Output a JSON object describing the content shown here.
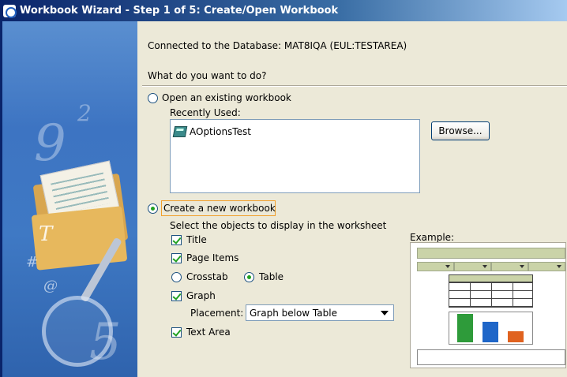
{
  "window": {
    "title": "Workbook Wizard - Step 1 of 5: Create/Open Workbook"
  },
  "header": {
    "connection": "Connected to the Database: MAT8IQA (EUL:TESTAREA)",
    "question": "What do you want to do?"
  },
  "open_option": {
    "label": "Open an existing workbook",
    "selected": false,
    "recently_used_label": "Recently Used:",
    "recent_items": [
      "AOptionsTest"
    ],
    "browse_label": "Browse..."
  },
  "create_option": {
    "label": "Create a new workbook",
    "selected": true,
    "instructions": "Select the objects to display in the worksheet",
    "title_label": "Title",
    "title_checked": true,
    "page_items_label": "Page Items",
    "page_items_checked": true,
    "crosstab_label": "Crosstab",
    "crosstab_selected": false,
    "table_label": "Table",
    "table_selected": true,
    "graph_label": "Graph",
    "graph_checked": true,
    "placement_label": "Placement:",
    "placement_value": "Graph below Table",
    "text_area_label": "Text Area",
    "text_area_checked": true
  },
  "example": {
    "label": "Example:",
    "colors": {
      "bar1": "#2e9b3a",
      "bar2": "#1f66c8",
      "bar3": "#e0621f"
    }
  }
}
